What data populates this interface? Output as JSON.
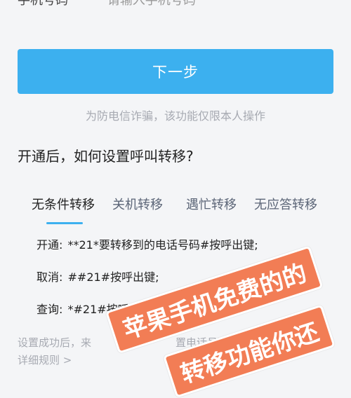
{
  "top_partial": {
    "left_text": "手机号码",
    "placeholder": "请输入手机号码"
  },
  "next_button": "下一步",
  "notice": "为防电信诈骗，该功能仅限本人操作",
  "question": "开通后，如何设置呼叫转移?",
  "tabs": [
    {
      "label": "无条件转移",
      "active": true
    },
    {
      "label": "关机转移",
      "active": false
    },
    {
      "label": "遇忙转移",
      "active": false
    },
    {
      "label": "无应答转移",
      "active": false
    }
  ],
  "instructions": [
    {
      "label": "开通:",
      "value": "**21*要转移到的电话号码#按呼出键;"
    },
    {
      "label": "取消:",
      "value": "##21#按呼出键;"
    },
    {
      "label": "查询:",
      "value": "*#21#按呼出键;"
    }
  ],
  "footer": {
    "text_left": "设置成功后，来",
    "text_right": "置电话号码",
    "detail_link": "详细规则 >"
  },
  "overlay": {
    "line1": "苹果手机免费的的",
    "line2": "转移功能你还"
  },
  "colors": {
    "accent": "#3cb0ef",
    "stamp": "#f27d55",
    "muted": "#a7aab2"
  }
}
